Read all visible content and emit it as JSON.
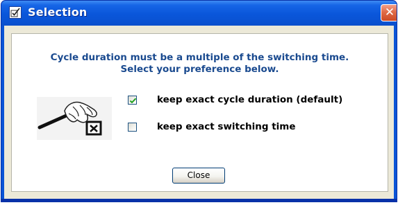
{
  "window": {
    "title": "Selection",
    "title_icon": "window-icon",
    "close_glyph": "✕"
  },
  "dialog": {
    "message_line1": "Cycle duration must be a multiple of the switching time.",
    "message_line2": "Select your preference below.",
    "illustration": "hand-pen-checkbox-icon",
    "options": [
      {
        "label": "keep exact cycle duration (default)",
        "checked": true
      },
      {
        "label": "keep exact switching time",
        "checked": false
      }
    ],
    "close_button": "Close"
  },
  "colors": {
    "titlebar": "#0a54d6",
    "message_text": "#1a4a8f",
    "checkmark": "#21a121",
    "close_button_red": "#d5552f"
  }
}
